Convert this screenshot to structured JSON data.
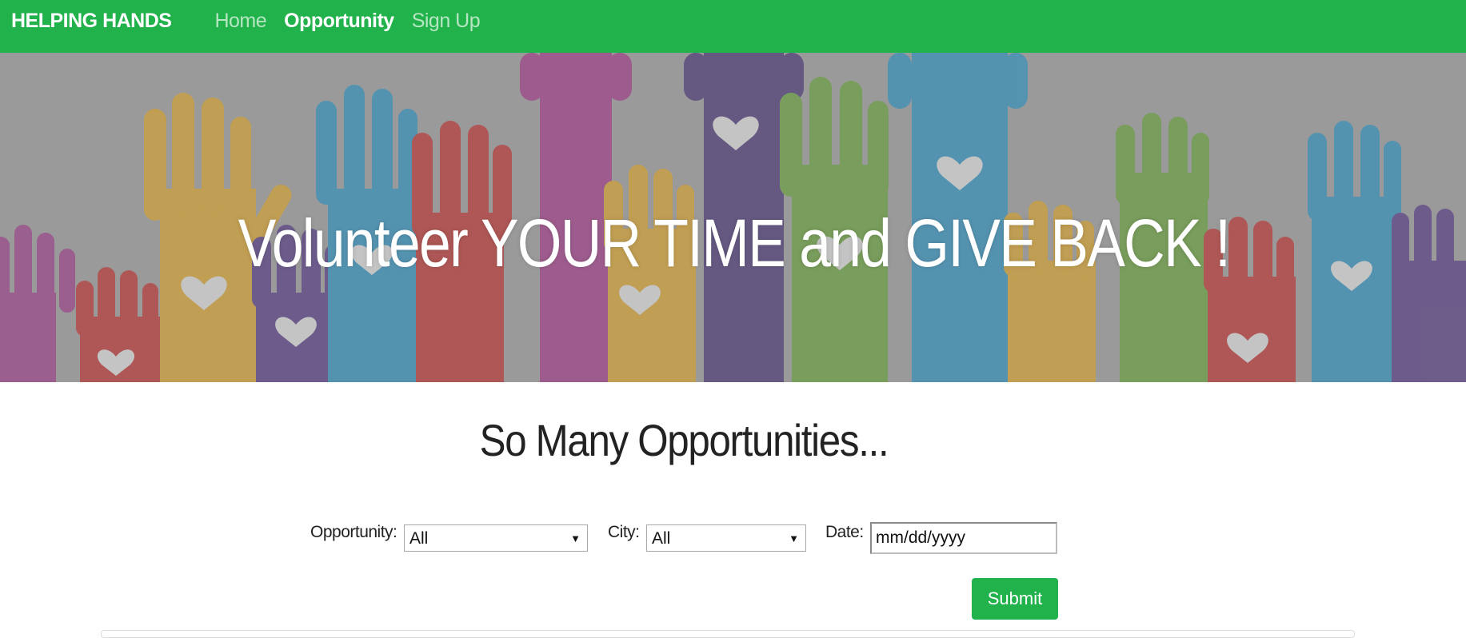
{
  "navbar": {
    "brand": "HELPING HANDS",
    "links": [
      {
        "label": "Home",
        "active": false
      },
      {
        "label": "Opportunity",
        "active": true
      },
      {
        "label": "Sign Up",
        "active": false
      }
    ],
    "bg_color": "#21b24c"
  },
  "hero": {
    "title": "Volunteer YOUR TIME and GIVE BACK !",
    "image": "raised-hands-with-hearts"
  },
  "main": {
    "heading": "So Many Opportunities...",
    "filters": {
      "opportunity_label": "Opportunity:",
      "opportunity_value": "All",
      "city_label": "City:",
      "city_value": "All",
      "date_label": "Date:",
      "date_placeholder": "mm/dd/yyyy"
    },
    "submit_label": "Submit"
  },
  "colors": {
    "accent": "#21b24c"
  }
}
